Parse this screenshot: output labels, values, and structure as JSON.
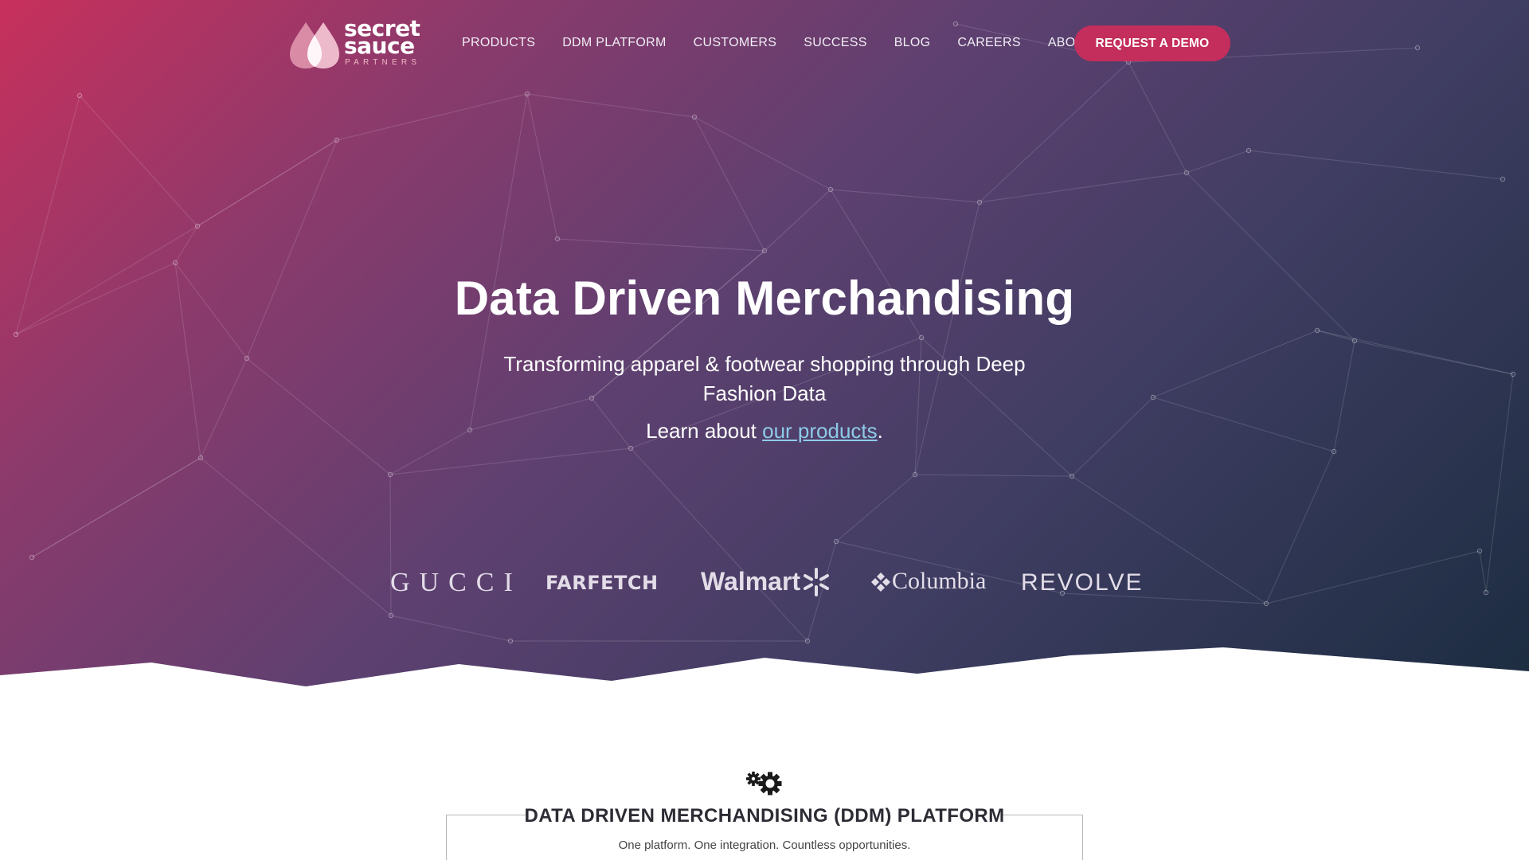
{
  "brand": {
    "logo_line1": "secret",
    "logo_line2": "sauce",
    "logo_line3": "PARTNERS"
  },
  "nav": {
    "items": [
      "PRODUCTS",
      "DDM PLATFORM",
      "CUSTOMERS",
      "SUCCESS",
      "BLOG",
      "CAREERS",
      "ABOUT"
    ],
    "cta_label": "REQUEST A DEMO"
  },
  "hero": {
    "title": "Data Driven Merchandising",
    "subtitle": "Transforming apparel & footwear shopping through Deep Fashion Data",
    "learn_prefix": "Learn about ",
    "learn_link": "our products",
    "learn_suffix": "."
  },
  "clients": {
    "gucci": "GUCCI",
    "farfetch": "FARFETCH",
    "walmart": "Walmart",
    "columbia": "Columbia",
    "revolve": "REVOLVE"
  },
  "platform": {
    "icon": "gears-icon",
    "title": "DATA DRIVEN MERCHANDISING (DDM) PLATFORM",
    "subtitle": "One platform. One integration. Countless opportunities."
  },
  "colors": {
    "accent": "#c42e5c",
    "link": "#8ecbe8",
    "hero_start": "#c8305c",
    "hero_end": "#1b2c40"
  }
}
